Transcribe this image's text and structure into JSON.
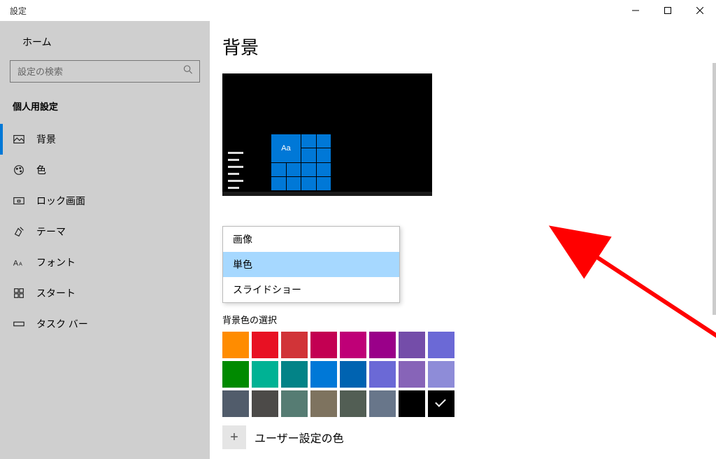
{
  "window": {
    "title": "設定"
  },
  "sidebar": {
    "home": "ホーム",
    "search_placeholder": "設定の検索",
    "section": "個人用設定",
    "items": [
      {
        "label": "背景",
        "active": true
      },
      {
        "label": "色"
      },
      {
        "label": "ロック画面"
      },
      {
        "label": "テーマ"
      },
      {
        "label": "フォント"
      },
      {
        "label": "スタート"
      },
      {
        "label": "タスク バー"
      }
    ]
  },
  "main": {
    "heading": "背景",
    "preview_tile_text": "Aa",
    "dropdown": {
      "options": [
        "画像",
        "単色",
        "スライドショー"
      ],
      "selected": 1
    },
    "color_section_label": "背景色の選択",
    "colors": [
      [
        "#ff8c00",
        "#e81123",
        "#d13438",
        "#c30052",
        "#bf0077",
        "#9a0089",
        "#744da9",
        "#6b69d6"
      ],
      [
        "#008a00",
        "#00b294",
        "#038387",
        "#0078d7",
        "#0063b1",
        "#6b69d6",
        "#8764b8",
        "#8e8cd8"
      ],
      [
        "#515c6b",
        "#4c4a48",
        "#567c73",
        "#7e735f",
        "#525e54",
        "#68768a",
        "#000000",
        "#000000"
      ]
    ],
    "checked_color": [
      2,
      7
    ],
    "custom_color_label": "ユーザー設定の色"
  }
}
